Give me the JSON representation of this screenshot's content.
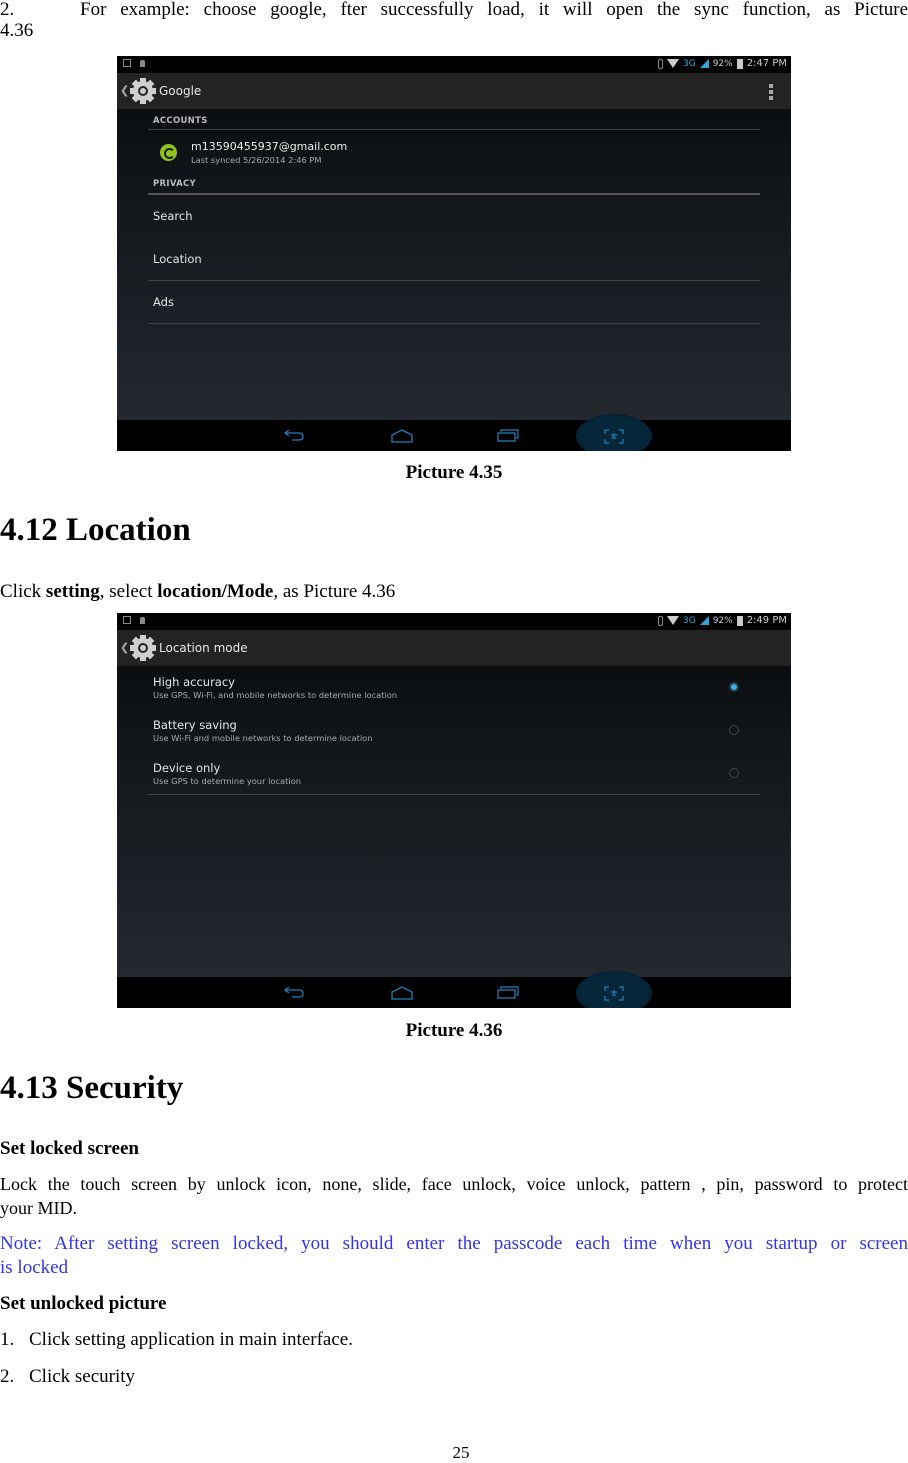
{
  "intro": {
    "number": "2.",
    "text": "For example: choose google, fter successfully load, it will open the sync function, as Picture",
    "continuation": "4.36"
  },
  "screenshot_google": {
    "status_bar": {
      "network": "3G",
      "battery": "92%",
      "time": "2:47 PM",
      "time_main": "2:47",
      "ampm": "PM"
    },
    "title": "Google",
    "sections": {
      "accounts": "ACCOUNTS",
      "privacy": "PRIVACY"
    },
    "account": {
      "email": "m13590455937@gmail.com",
      "last_synced": "Last synced 5/26/2014 2:46 PM"
    },
    "privacy_items": [
      "Search",
      "Location",
      "Ads"
    ],
    "accent_color": "#33b5e5",
    "sync_color": "#8fc31f"
  },
  "caption_1": "Picture 4.35",
  "section_412": {
    "heading": "4.12 Location",
    "para_prefix": "Click ",
    "para_bold1": "setting",
    "para_mid": ", select ",
    "para_bold2": "location/Mode",
    "para_suffix": ", as Picture 4.36"
  },
  "screenshot_location": {
    "status_bar": {
      "network": "3G",
      "battery": "92%",
      "time": "2:49 PM",
      "time_main": "2:49",
      "ampm": "PM"
    },
    "title": "Location mode",
    "options": [
      {
        "label": "High accuracy",
        "description": "Use GPS, Wi-Fi, and mobile networks to determine location",
        "selected": true
      },
      {
        "label": "Battery saving",
        "description": "Use Wi-Fi and mobile networks to determine location",
        "selected": false
      },
      {
        "label": "Device only",
        "description": "Use GPS to determine your location",
        "selected": false
      }
    ]
  },
  "caption_2": "Picture 4.36",
  "section_413": {
    "heading": "4.13 Security",
    "sub1": "Set locked screen",
    "para1_line1": "Lock the touch screen by unlock icon, none, slide, face unlock, voice unlock, pattern , pin, password to protect",
    "para1_line2": "your MID.",
    "note_line1": "Note: After setting screen locked, you should enter the passcode each time when you startup or screen",
    "note_line2": "is locked",
    "note_color": "#3333ee",
    "sub2": "Set unlocked picture",
    "steps": [
      {
        "num": "1.",
        "text": "Click setting application in main interface."
      },
      {
        "num": "2.",
        "text": "Click security"
      }
    ]
  },
  "page_number": "25"
}
